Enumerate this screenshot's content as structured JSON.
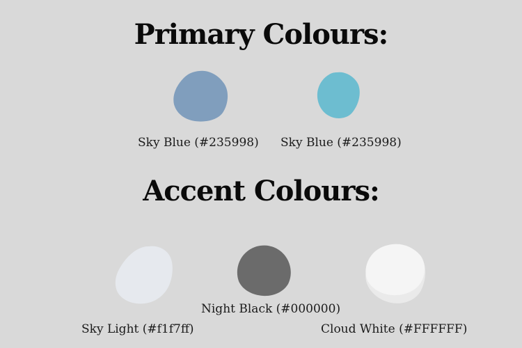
{
  "primary": {
    "heading": "Primary Colours:",
    "swatches": [
      {
        "label": "Sky Blue (#235998)",
        "color": "#809ebd"
      },
      {
        "label": "Sky Blue (#235998)",
        "color": "#6dbdd0"
      }
    ]
  },
  "accent": {
    "heading": "Accent Colours:",
    "swatches": [
      {
        "label": "Sky Light (#f1f7ff)",
        "color": "#e6e9ee"
      },
      {
        "label": "Night Black (#000000)",
        "color": "#6b6b6b"
      },
      {
        "label": "Cloud White (#FFFFFF)",
        "color": "#f5f5f5"
      }
    ]
  }
}
